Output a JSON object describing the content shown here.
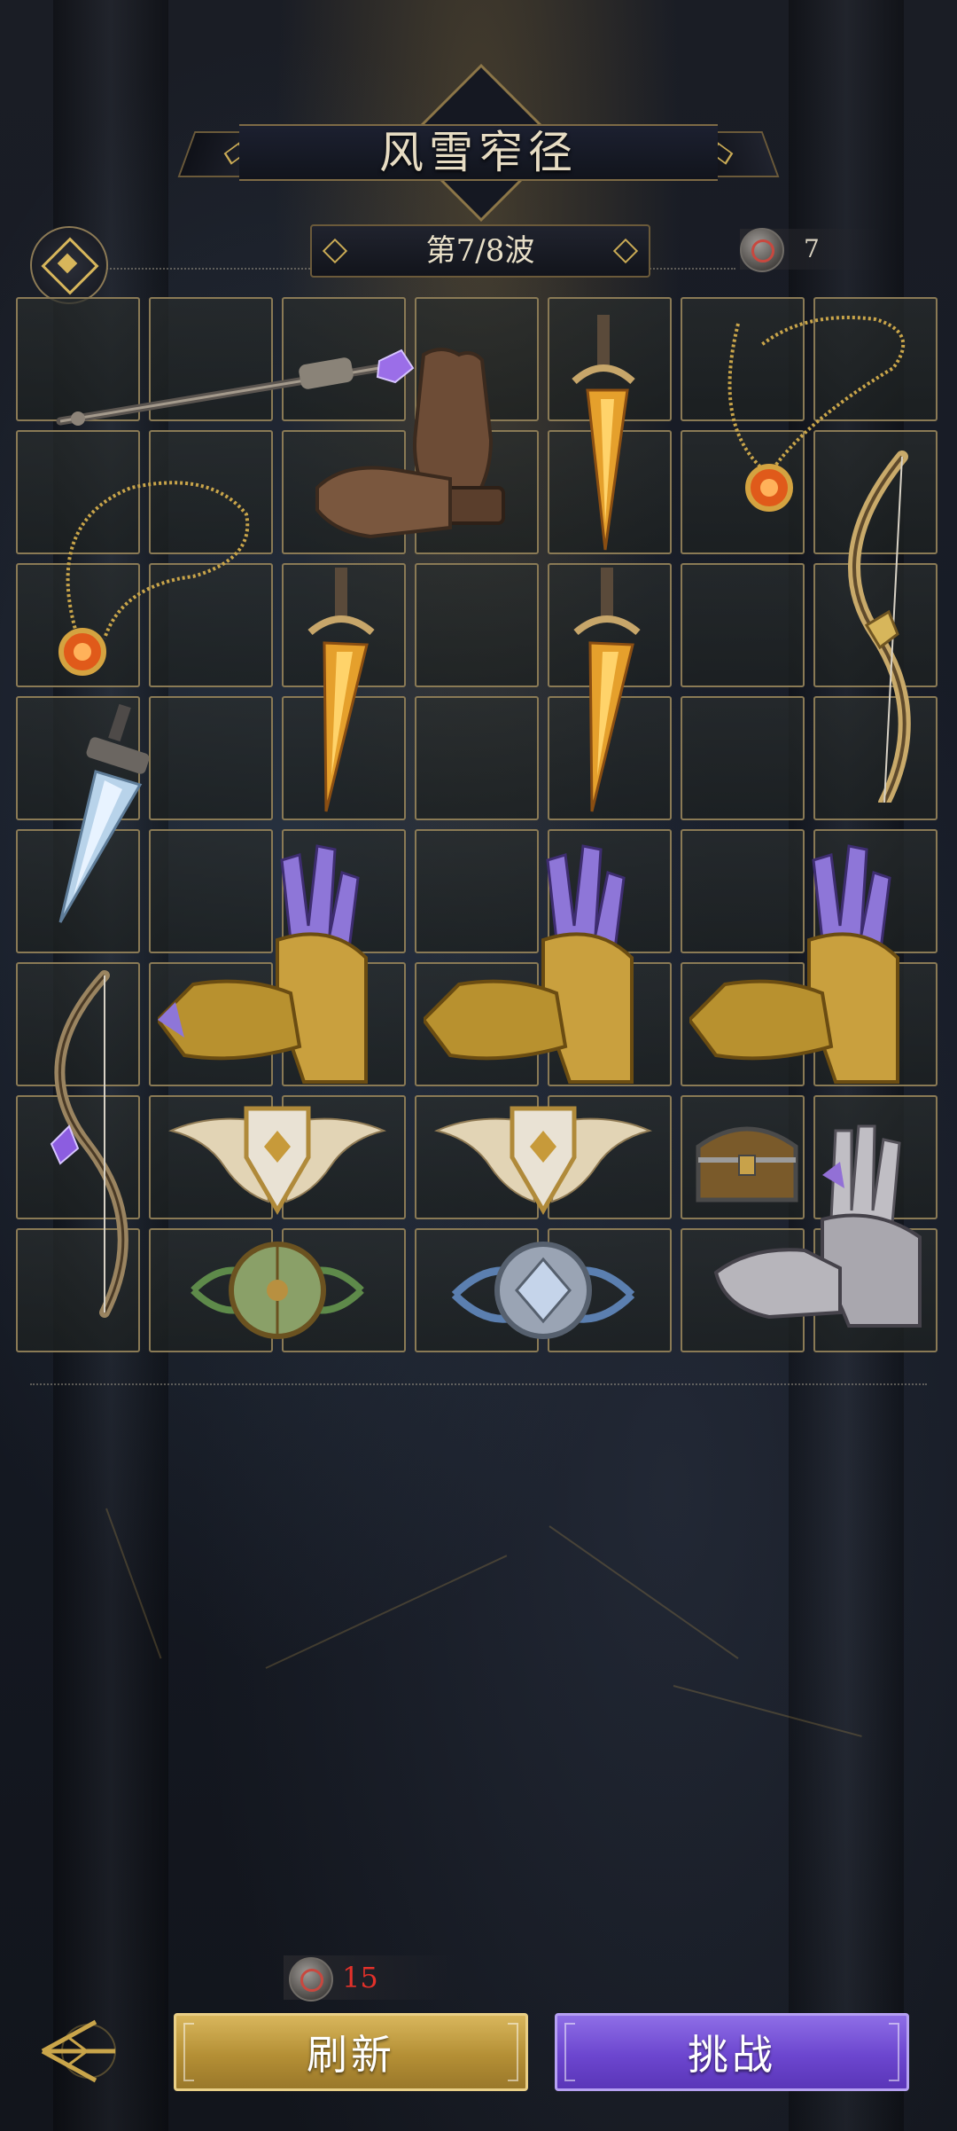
{
  "header": {
    "title": "风雪窄径",
    "wave_label": "第7/8波",
    "currency_icon": "rune-coin-icon",
    "currency_amount": "7",
    "emblem_icon": "diamond-emblem-icon"
  },
  "grid": {
    "columns": 7,
    "rows": 8,
    "items": [
      {
        "name": "staff",
        "icon": "purple-crystal-staff"
      },
      {
        "name": "gloves",
        "icon": "leather-gloves"
      },
      {
        "name": "dagger",
        "icon": "fire-dagger"
      },
      {
        "name": "amulet",
        "icon": "sun-amulet"
      },
      {
        "name": "amulet",
        "icon": "sun-amulet"
      },
      {
        "name": "bow",
        "icon": "gilded-bow"
      },
      {
        "name": "dagger",
        "icon": "fire-dagger"
      },
      {
        "name": "dagger",
        "icon": "fire-dagger"
      },
      {
        "name": "sword",
        "icon": "frost-sword"
      },
      {
        "name": "gauntlet",
        "icon": "golden-claw-gauntlet"
      },
      {
        "name": "gauntlet",
        "icon": "golden-claw-gauntlet"
      },
      {
        "name": "gauntlet",
        "icon": "golden-claw-gauntlet"
      },
      {
        "name": "bow",
        "icon": "amethyst-bow"
      },
      {
        "name": "shield",
        "icon": "winged-shield"
      },
      {
        "name": "shield",
        "icon": "winged-shield"
      },
      {
        "name": "chest",
        "icon": "treasure-chest"
      },
      {
        "name": "gauntlet",
        "icon": "steel-gauntlet"
      },
      {
        "name": "shield",
        "icon": "wooden-round-shield"
      },
      {
        "name": "shield",
        "icon": "silver-laurel-shield"
      }
    ]
  },
  "footer": {
    "refresh_cost": "15",
    "refresh_label": "刷新",
    "challenge_label": "挑战",
    "back_icon": "back-arrow-icon"
  },
  "colors": {
    "frame_gold": "#8a7a55",
    "refresh_gold": "#c9a54a",
    "challenge_purple": "#7450d6",
    "cost_red": "#e2312a"
  }
}
